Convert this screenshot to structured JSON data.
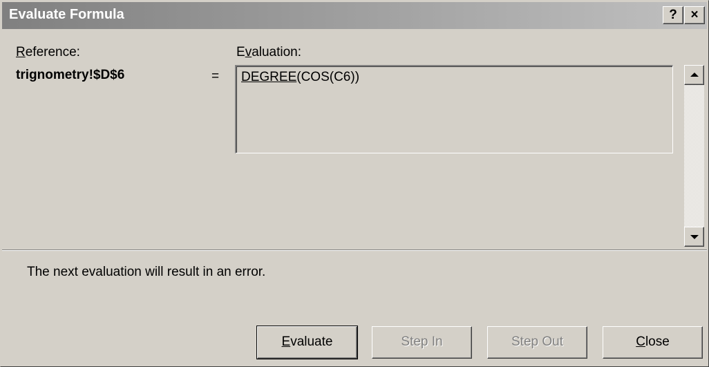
{
  "window": {
    "title": "Evaluate Formula",
    "help_glyph": "?",
    "close_glyph": "×"
  },
  "reference": {
    "label_mnemonic": "R",
    "label_rest": "eference:",
    "value": "trignometry!$D$6",
    "equals": "="
  },
  "evaluation": {
    "label_start": "E",
    "label_mnemonic": "v",
    "label_rest": "aluation:",
    "formula_underlined": "DEGREE",
    "formula_rest": "(COS(C6))"
  },
  "message": "The next evaluation will result in an error.",
  "buttons": {
    "evaluate": {
      "mnemonic": "E",
      "rest": "valuate"
    },
    "step_in": "Step In",
    "step_out": "Step Out",
    "close": {
      "mnemonic": "C",
      "rest": "lose"
    }
  },
  "scrollbar": {
    "up_icon": "scroll-up-arrow",
    "down_icon": "scroll-down-arrow"
  },
  "colors": {
    "dialog_face": "#d4d0c8",
    "titlebar_gradient_start": "#808080",
    "titlebar_gradient_end": "#c0c0c0",
    "disabled_text": "#808080"
  }
}
